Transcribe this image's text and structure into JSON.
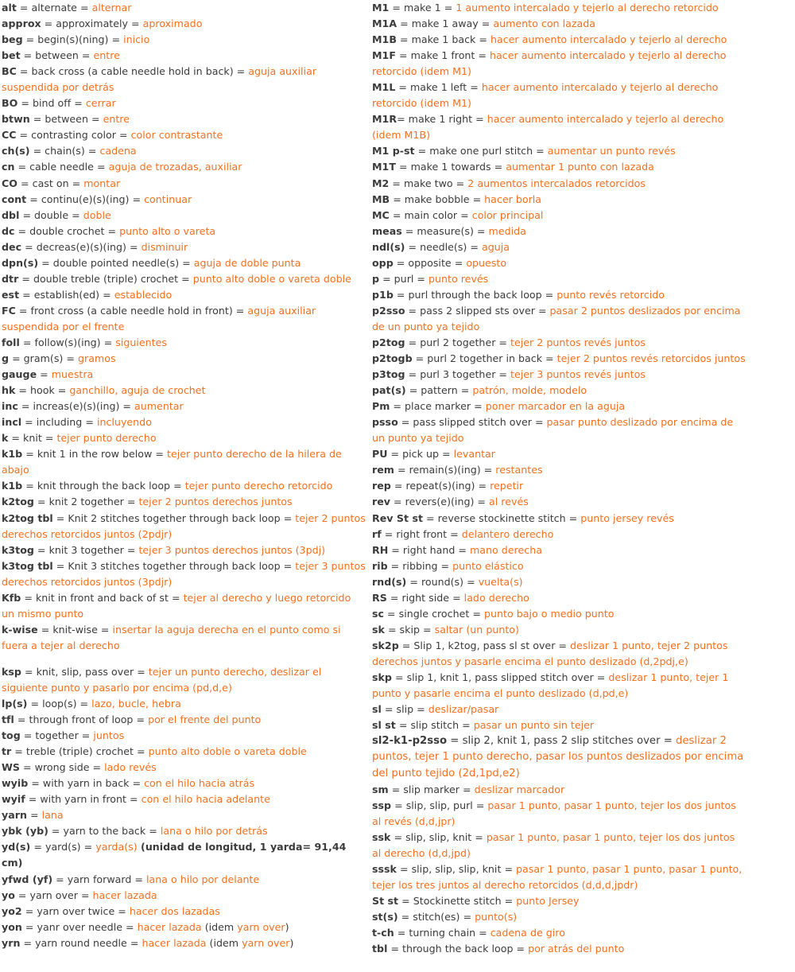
{
  "meta": {
    "colors": {
      "spanish_text": "#f4701f",
      "english_text": "#3b3b3b",
      "background": "#ffffff"
    }
  },
  "columns": {
    "left": [
      {
        "abbr": "alt",
        "en": "alternate",
        "es": "alternar"
      },
      {
        "abbr": "approx",
        "en": "approximately",
        "es": "aproximado"
      },
      {
        "abbr": "beg",
        "en": "begin(s)(ning)",
        "es": "inicio"
      },
      {
        "abbr": "bet",
        "en": "between",
        "es": "entre"
      },
      {
        "abbr": "BC",
        "en": "back cross (a cable needle hold in back)",
        "es": "aguja auxiliar suspendida por detrás"
      },
      {
        "abbr": "BO",
        "en": "bind off",
        "es": "cerrar"
      },
      {
        "abbr": "btwn",
        "en": "between",
        "es": "entre"
      },
      {
        "abbr": "CC",
        "en": "contrasting color",
        "es": "color contrastante"
      },
      {
        "abbr": "ch(s)",
        "en": "chain(s)",
        "es": "cadena"
      },
      {
        "abbr": "cn",
        "en": "cable needle",
        "es": "aguja de trozadas, auxiliar"
      },
      {
        "abbr": "CO",
        "en": "cast on",
        "es": "montar"
      },
      {
        "abbr": "cont",
        "en": "continu(e)(s)(ing)",
        "es": "continuar"
      },
      {
        "abbr": "dbl",
        "en": "double",
        "es": "doble"
      },
      {
        "abbr": "dc",
        "en": "double crochet",
        "es": "punto alto o vareta"
      },
      {
        "abbr": "dec",
        "en": "decreas(e)(s)(ing)",
        "es": "disminuir"
      },
      {
        "abbr": "dpn(s)",
        "en": "double pointed needle(s)",
        "es": "aguja de doble punta"
      },
      {
        "abbr": "dtr",
        "en": "double treble (triple) crochet",
        "es": "punto alto doble o vareta doble"
      },
      {
        "abbr": "est",
        "en": "establish(ed)",
        "es": "establecido"
      },
      {
        "abbr": "FC",
        "en": "front cross (a cable needle hold in front)",
        "es": "aguja auxiliar suspendida por el frente"
      },
      {
        "abbr": "foll",
        "en": "follow(s)(ing)",
        "es": "siguientes"
      },
      {
        "abbr": "g",
        "en": "gram(s)",
        "es": "gramos"
      },
      {
        "abbr": "gauge",
        "en": "",
        "es": "muestra"
      },
      {
        "abbr": "hk",
        "en": "hook",
        "es": "ganchillo, aguja de crochet"
      },
      {
        "abbr": "inc",
        "en": "increas(e)(s)(ing)",
        "es": "aumentar"
      },
      {
        "abbr": "incl",
        "en": "including",
        "es": "incluyendo"
      },
      {
        "abbr": "k",
        "en": "knit",
        "es": "tejer punto derecho"
      },
      {
        "abbr": "k1b",
        "en": "knit 1 in the row below",
        "es": "tejer punto derecho de la hilera de abajo"
      },
      {
        "abbr": "k1b",
        "en": "knit through the back loop",
        "es": "tejer punto derecho retorcido"
      },
      {
        "abbr": "k2tog",
        "en": "knit 2 together",
        "es": "tejer 2 puntos derechos juntos"
      },
      {
        "abbr": "k2tog tbl",
        "en": "Knit 2 stitches together through back loop",
        "es": "tejer 2 puntos derechos retorcidos juntos (2pdjr)"
      },
      {
        "abbr": "k3tog",
        "en": "knit 3 together",
        "es": "tejer 3 puntos derechos juntos (3pdj)"
      },
      {
        "abbr": "k3tog tbl",
        "en": "Knit 3 stitches together through back loop",
        "es": "tejer 3 puntos derechos retorcidos juntos (3pdjr)"
      },
      {
        "abbr": "Kfb",
        "en": "knit in front and back of st",
        "es": "tejer al derecho y luego retorcido un mismo punto"
      },
      {
        "abbr": "k-wise",
        "en": "knit-wise",
        "es": "insertar la aguja derecha en el punto como si fuera a tejer al derecho"
      },
      {
        "abbr": "ksp",
        "en": "knit, slip, pass over",
        "es": "tejer un punto derecho, deslizar el siguiente punto y pasarlo por encima (pd,d,e)",
        "gap_before": true
      },
      {
        "abbr": "lp(s)",
        "en": "loop(s)",
        "es": "lazo, bucle, hebra"
      },
      {
        "abbr": "tfl",
        "en": "through front of loop",
        "es": "por el frente del punto"
      },
      {
        "abbr": "tog",
        "en": "together",
        "es": "juntos"
      },
      {
        "abbr": "tr",
        "en": "treble (triple) crochet",
        "es": "punto alto doble o vareta doble"
      },
      {
        "abbr": "WS",
        "en": "wrong side",
        "es": "lado revés"
      },
      {
        "abbr": "wyib",
        "en": "with yarn in back",
        "es": "con el hilo hacia atrás"
      },
      {
        "abbr": "wyif",
        "en": "with yarn in front",
        "es": "con el hilo hacia adelante"
      },
      {
        "abbr": "yarn",
        "en": "",
        "es": "lana"
      },
      {
        "abbr": "ybk (yb)",
        "en": "yarn to the back",
        "es": "lana o hilo por detrás"
      },
      {
        "abbr": "yd(s)",
        "en": "yard(s)",
        "es": "yarda(s)",
        "note_bold": " (unidad de longitud, 1 yarda= 91,44 cm)"
      },
      {
        "abbr": "yfwd (yf)",
        "en": "yarn forward",
        "es": "lana o hilo por delante"
      },
      {
        "abbr": "yo",
        "en": "yarn over",
        "es": "hacer lazada"
      },
      {
        "abbr": "yo2",
        "en": "yarn over twice",
        "es": "hacer dos lazadas"
      },
      {
        "abbr": "yon",
        "en": "yanr over needle",
        "es": "hacer lazada",
        "note": " (idem ",
        "note_es": "yarn over",
        "note_tail": ")"
      },
      {
        "abbr": "yrn",
        "en": "yarn round needle",
        "es": "hacer lazada",
        "note": " (idem ",
        "note_es": "yarn over",
        "note_tail": ")"
      }
    ],
    "right": [
      {
        "abbr": "M1",
        "en": "make 1",
        "es": "1 aumento intercalado y tejerlo al derecho retorcido"
      },
      {
        "abbr": "M1A",
        "en": "make 1 away",
        "es": "aumento con lazada"
      },
      {
        "abbr": "M1B",
        "en": "make 1 back",
        "es": "hacer aumento intercalado y tejerlo al derecho"
      },
      {
        "abbr": "M1F",
        "en": "make 1 front",
        "es": "hacer aumento intercalado y tejerlo al derecho retorcido (idem M1)"
      },
      {
        "abbr": "M1L",
        "en": "make 1 left",
        "es": "hacer aumento intercalado y tejerlo al derecho retorcido (idem M1)"
      },
      {
        "abbr": "M1R",
        "en": "make 1 right",
        "es": "hacer aumento intercalado y tejerlo al derecho (idem M1B)",
        "no_space_eq": true
      },
      {
        "abbr": "M1 p-st",
        "en": "make one purl stitch",
        "es": "aumentar un punto revés"
      },
      {
        "abbr": "M1T",
        "en": "make 1 towards",
        "es": "aumentar 1 punto con lazada"
      },
      {
        "abbr": "M2",
        "en": "make two",
        "es": "2 aumentos intercalados retorcidos"
      },
      {
        "abbr": "MB",
        "en": "make bobble",
        "es": "hacer borla"
      },
      {
        "abbr": "MC",
        "en": "main color",
        "es": "color principal"
      },
      {
        "abbr": "meas",
        "en": "measure(s)",
        "es": "medida"
      },
      {
        "abbr": "ndl(s)",
        "en": "needle(s)",
        "es": "aguja"
      },
      {
        "abbr": "opp",
        "en": "opposite",
        "es": "opuesto"
      },
      {
        "abbr": "p",
        "en": "purl",
        "es": "punto revés"
      },
      {
        "abbr": "p1b",
        "en": "purl through the back loop",
        "es": "punto revés retorcido"
      },
      {
        "abbr": "p2sso",
        "en": "pass 2 slipped sts over",
        "es": "pasar 2 puntos deslizados por encima de un punto ya tejido"
      },
      {
        "abbr": "p2tog",
        "en": "purl 2 together",
        "es": "tejer 2 puntos revés juntos"
      },
      {
        "abbr": "p2togb",
        "en": "purl 2 together in back",
        "es": "tejer 2 puntos revés retorcidos juntos"
      },
      {
        "abbr": "p3tog",
        "en": "purl 3 together",
        "es": "tejer 3 puntos revés juntos"
      },
      {
        "abbr": "pat(s)",
        "en": "pattern",
        "es": "patrón, molde, modelo"
      },
      {
        "abbr": "Pm",
        "en": "place marker",
        "es": "poner marcador en la aguja"
      },
      {
        "abbr": "psso",
        "en": "pass slipped stitch over",
        "es": "pasar punto deslizado por encima de un punto ya tejido"
      },
      {
        "abbr": "PU",
        "en": "pick up",
        "es": "levantar"
      },
      {
        "abbr": "rem",
        "en": "remain(s)(ing)",
        "es": "restantes"
      },
      {
        "abbr": "rep",
        "en": "repeat(s)(ing)",
        "es": "repetir"
      },
      {
        "abbr": "rev",
        "en": "revers(e)(ing)",
        "es": "al revés"
      },
      {
        "abbr": "Rev St st",
        "en": "reverse stockinette stitch",
        "es": "punto jersey revés"
      },
      {
        "abbr": "rf",
        "en": "right front",
        "es": "delantero derecho"
      },
      {
        "abbr": "RH",
        "en": "right hand",
        "es": "mano derecha"
      },
      {
        "abbr": "rib",
        "en": "ribbing",
        "es": "punto elástico"
      },
      {
        "abbr": "rnd(s)",
        "en": "round(s)",
        "es": "vuelta(s)"
      },
      {
        "abbr": "RS",
        "en": "right side",
        "es": "lado derecho"
      },
      {
        "abbr": "sc",
        "en": "single crochet",
        "es": "punto bajo o medio punto"
      },
      {
        "abbr": "sk",
        "en": "skip",
        "es": "saltar (un punto)"
      },
      {
        "abbr": "sk2p",
        "en": "Slip 1, k2tog, pass sl st over",
        "es": "deslizar 1 punto, tejer 2 puntos derechos juntos y pasarle encima el punto deslizado (d,2pdj,e)"
      },
      {
        "abbr": "skp",
        "en": "slip 1, knit 1, pass slipped stitch over",
        "es": "deslizar 1 punto, tejer 1 punto y pasarle encima el punto deslizado (d,pd,e)"
      },
      {
        "abbr": "sl",
        "en": "slip",
        "es": "deslizar/pasar"
      },
      {
        "abbr": "sl st",
        "en": "slip stitch",
        "es": "pasar un punto sin tejer"
      },
      {
        "abbr": "sl2-k1-p2sso",
        "en": "slip 2, knit 1, pass 2 slip stitches over",
        "es": "deslizar 2 puntos, tejer 1 punto derecho, pasar los puntos deslizados por encima del punto tejido (2d,1pd,e2)",
        "big": true
      },
      {
        "abbr": "sm",
        "en": "slip marker",
        "es": "deslizar marcador"
      },
      {
        "abbr": "ssp",
        "en": "slip, slip, purl",
        "es": "pasar 1 punto, pasar 1 punto, tejer los dos juntos al revés (d,d,jpr)"
      },
      {
        "abbr": "ssk",
        "en": "slip, slip, knit",
        "es": "pasar 1 punto, pasar 1 punto, tejer los dos juntos al derecho (d,d,jpd)"
      },
      {
        "abbr": "sssk",
        "en": "slip, slip, slip, knit",
        "es": "pasar 1 punto, pasar 1 punto, pasar 1 punto, tejer los tres juntos al derecho retorcidos (d,d,d,jpdr)"
      },
      {
        "abbr": "St st",
        "en": "Stockinette stitch",
        "es": "punto Jersey"
      },
      {
        "abbr": "st(s)",
        "en": "stitch(es)",
        "es": "punto(s)"
      },
      {
        "abbr": "t-ch",
        "en": "turning chain",
        "es": "cadena de giro"
      },
      {
        "abbr": "tbl",
        "en": "through the back loop",
        "es": "por atrás del punto"
      }
    ]
  }
}
